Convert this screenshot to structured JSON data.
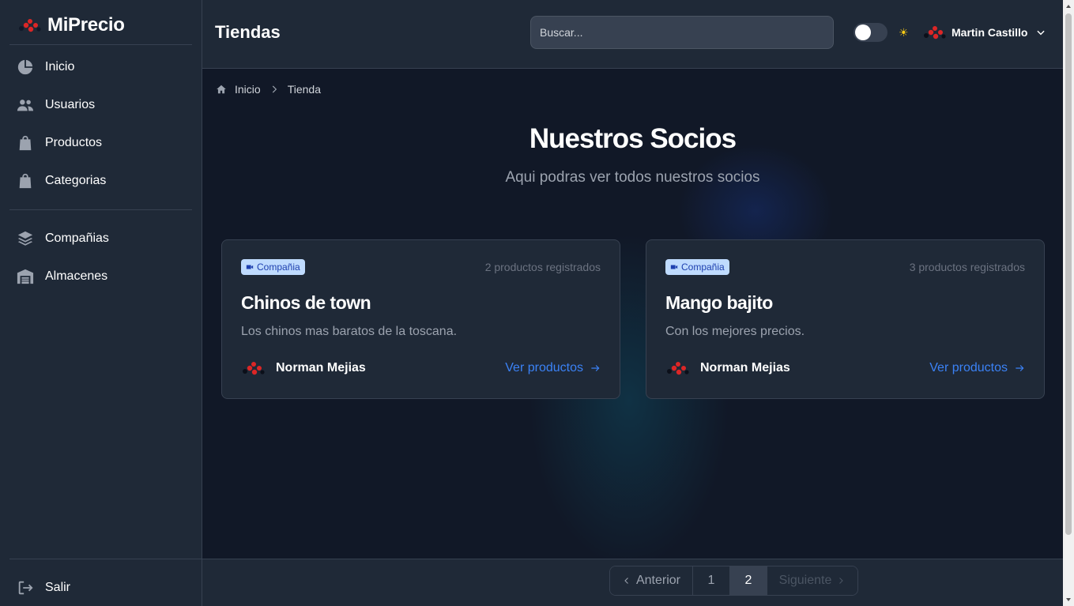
{
  "app": {
    "brand": "MiPrecio"
  },
  "sidebar": {
    "items": [
      {
        "label": "Inicio",
        "icon": "pie-chart-icon"
      },
      {
        "label": "Usuarios",
        "icon": "users-icon"
      },
      {
        "label": "Productos",
        "icon": "shopping-bag-icon"
      },
      {
        "label": "Categorias",
        "icon": "shopping-bag-icon"
      },
      {
        "label": "Compañias",
        "icon": "layers-icon"
      },
      {
        "label": "Almacenes",
        "icon": "warehouse-icon"
      }
    ],
    "logout": "Salir"
  },
  "header": {
    "title": "Tiendas",
    "search_placeholder": "Buscar...",
    "user_name": "Martin Castillo"
  },
  "breadcrumb": {
    "home": "Inicio",
    "current": "Tienda"
  },
  "hero": {
    "title": "Nuestros Socios",
    "subtitle": "Aqui podras ver todos nuestros socios"
  },
  "cards": [
    {
      "badge": "Compañia",
      "count": "2 productos registrados",
      "title": "Chinos de town",
      "description": "Los chinos mas baratos de la toscana.",
      "owner": "Norman Mejias",
      "link": "Ver productos"
    },
    {
      "badge": "Compañia",
      "count": "3 productos registrados",
      "title": "Mango bajito",
      "description": "Con los mejores precios.",
      "owner": "Norman Mejias",
      "link": "Ver productos"
    }
  ],
  "pagination": {
    "prev": "Anterior",
    "pages": [
      "1",
      "2"
    ],
    "current_page": "2",
    "next": "Siguiente"
  },
  "colors": {
    "background": "#111827",
    "panel": "#1f2937",
    "accent": "#3b82f6",
    "logo_red": "#dc2626"
  }
}
